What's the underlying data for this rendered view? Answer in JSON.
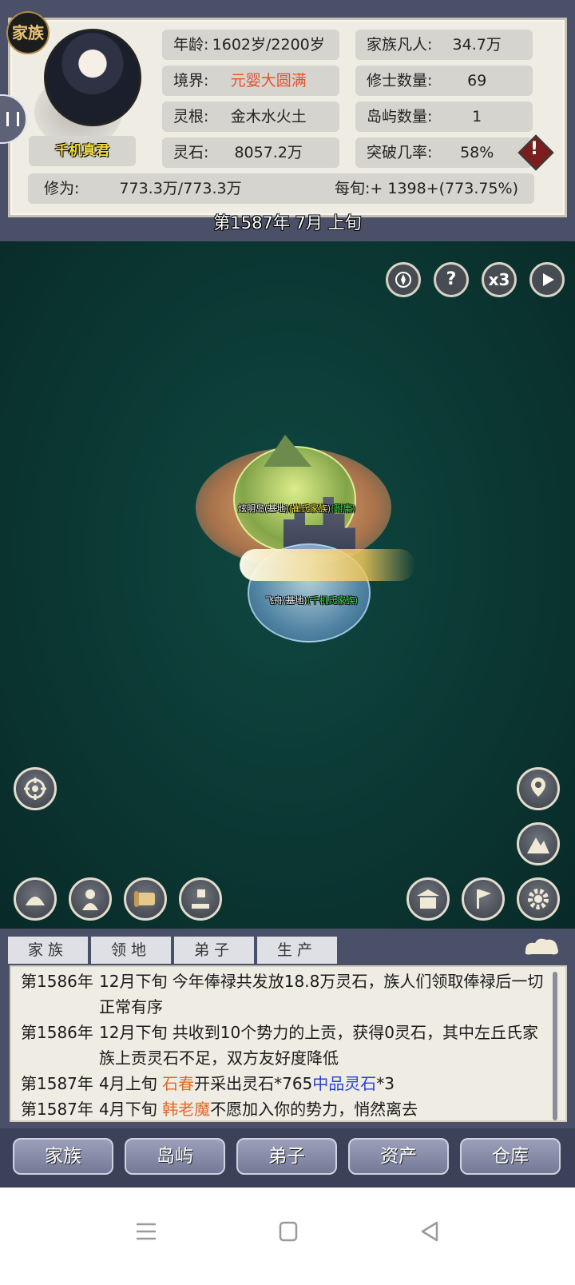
{
  "header": {
    "badge": "家族",
    "name": "千机真君",
    "stats": {
      "age_label": "年龄:",
      "age_value": "1602岁/2200岁",
      "realm_label": "境界:",
      "realm_value": "元婴大圆满",
      "root_label": "灵根:",
      "root_value": "金木水火土",
      "stone_label": "灵石:",
      "stone_value": "8057.2万",
      "mortals_label": "家族凡人:",
      "mortals_value": "34.7万",
      "cultivators_label": "修士数量:",
      "cultivators_value": "69",
      "islands_label": "岛屿数量:",
      "islands_value": "1",
      "breakthrough_label": "突破几率:",
      "breakthrough_value": "58%",
      "cultivation_label": "修为:",
      "cultivation_value": "773.3万/773.3万",
      "per_period_label": "每旬:",
      "per_period_value": "+ 1398+(773.75%)"
    },
    "date": "第1587年 7月 上旬"
  },
  "map": {
    "top_buttons": [
      "crest-icon",
      "?",
      "x3",
      "play-icon"
    ],
    "island_label_name": "炫明岛(基地)",
    "island_label_family": "(崔氏家族)",
    "island_label_tag": "(附庸)",
    "ship_label_name": "飞舟(基地)",
    "ship_label_family": "(千机氏家族)"
  },
  "log": {
    "tabs": [
      "家族",
      "领地",
      "弟子",
      "生产"
    ],
    "entries": [
      {
        "year": "第1586年",
        "text": "12月下旬 今年俸禄共发放18.8万灵石，族人们领取俸禄后一切正常有序"
      },
      {
        "year": "第1586年",
        "text": "12月下旬 共收到10个势力的上贡，获得0灵石，其中左丘氏家族上贡灵石不足，双方友好度降低"
      },
      {
        "year": "第1587年",
        "pre": "4月上旬 ",
        "hl": "石春",
        "mid": "开采出灵石*765",
        "hl2": "中品灵石",
        "post": "*3"
      },
      {
        "year": "第1587年",
        "pre": "4月下旬 ",
        "hl": "韩老魔",
        "mid": "不愿加入你的势力，悄然离去"
      }
    ]
  },
  "nav": [
    "家族",
    "岛屿",
    "弟子",
    "资产",
    "仓库"
  ],
  "colors": {
    "frame": "#4a5068",
    "panel": "#efece3",
    "sea": "#0b3733",
    "accent_red": "#e5522e"
  }
}
